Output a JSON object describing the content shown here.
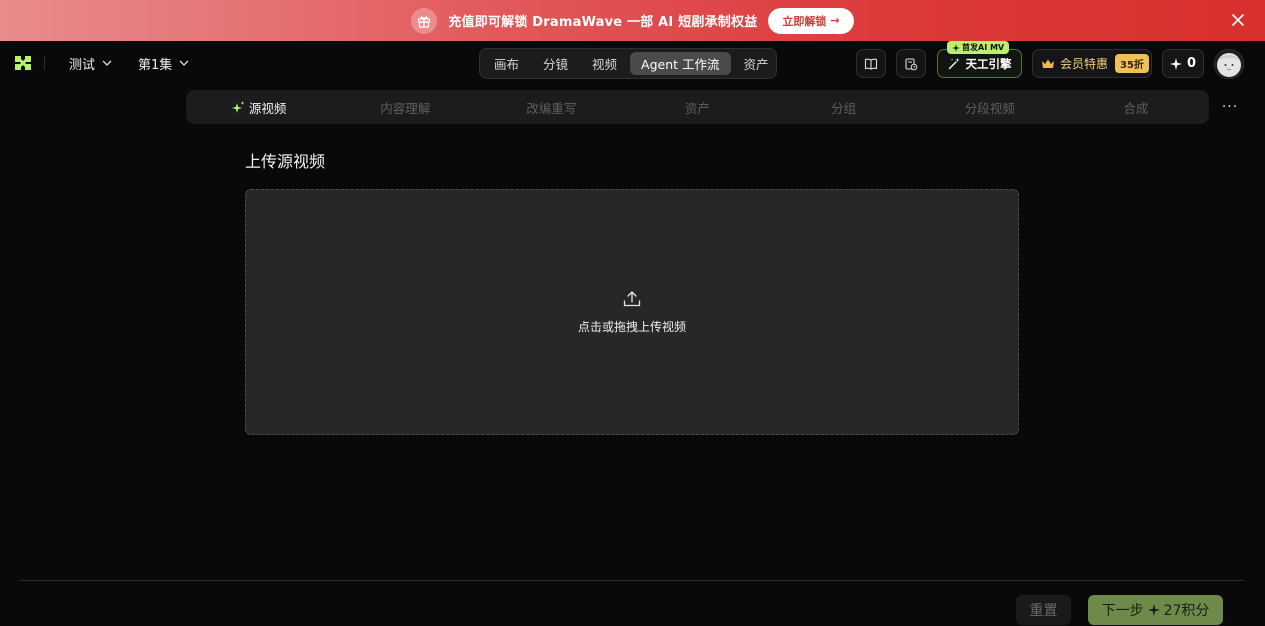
{
  "banner": {
    "text": "充值即可解锁 DramaWave 一部 AI 短剧承制权益",
    "cta_label": "立即解锁",
    "cta_arrow": "→",
    "bg_color": "#dc3a3a"
  },
  "header": {
    "project_name": "测试",
    "episode_name": "第1集",
    "tabs": [
      {
        "label": "画布",
        "active": false
      },
      {
        "label": "分镜",
        "active": false
      },
      {
        "label": "视频",
        "active": false
      },
      {
        "label": "Agent 工作流",
        "active": true
      },
      {
        "label": "资产",
        "active": false
      }
    ],
    "engine_badge": "首发AI MV",
    "engine_label": "天工引擎",
    "vip_label": "会员特惠",
    "vip_discount": "35折",
    "credits_count": "0",
    "accent_color": "#b9f26a"
  },
  "steps": [
    {
      "label": "源视频",
      "active": true
    },
    {
      "label": "内容理解",
      "active": false
    },
    {
      "label": "改编重写",
      "active": false
    },
    {
      "label": "资产",
      "active": false
    },
    {
      "label": "分组",
      "active": false
    },
    {
      "label": "分段视频",
      "active": false
    },
    {
      "label": "合成",
      "active": false
    }
  ],
  "more_label": "···",
  "main": {
    "title": "上传源视频",
    "upload_hint": "点击或拖拽上传视频"
  },
  "footer": {
    "reset_label": "重置",
    "next_label": "下一步",
    "next_cost": "27积分",
    "next_color": "#6d8a4a"
  }
}
